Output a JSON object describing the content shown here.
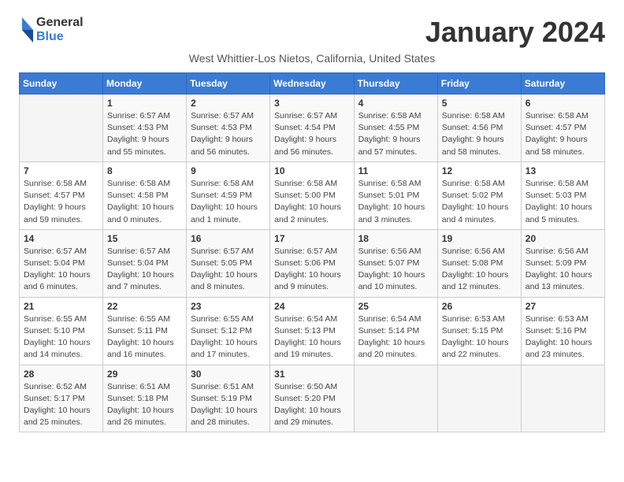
{
  "header": {
    "logo_line1": "General",
    "logo_line2": "Blue",
    "month_year": "January 2024",
    "subtitle": "West Whittier-Los Nietos, California, United States"
  },
  "days_of_week": [
    "Sunday",
    "Monday",
    "Tuesday",
    "Wednesday",
    "Thursday",
    "Friday",
    "Saturday"
  ],
  "weeks": [
    [
      {
        "day": "",
        "info": ""
      },
      {
        "day": "1",
        "info": "Sunrise: 6:57 AM\nSunset: 4:53 PM\nDaylight: 9 hours\nand 55 minutes."
      },
      {
        "day": "2",
        "info": "Sunrise: 6:57 AM\nSunset: 4:53 PM\nDaylight: 9 hours\nand 56 minutes."
      },
      {
        "day": "3",
        "info": "Sunrise: 6:57 AM\nSunset: 4:54 PM\nDaylight: 9 hours\nand 56 minutes."
      },
      {
        "day": "4",
        "info": "Sunrise: 6:58 AM\nSunset: 4:55 PM\nDaylight: 9 hours\nand 57 minutes."
      },
      {
        "day": "5",
        "info": "Sunrise: 6:58 AM\nSunset: 4:56 PM\nDaylight: 9 hours\nand 58 minutes."
      },
      {
        "day": "6",
        "info": "Sunrise: 6:58 AM\nSunset: 4:57 PM\nDaylight: 9 hours\nand 58 minutes."
      }
    ],
    [
      {
        "day": "7",
        "info": "Sunrise: 6:58 AM\nSunset: 4:57 PM\nDaylight: 9 hours\nand 59 minutes."
      },
      {
        "day": "8",
        "info": "Sunrise: 6:58 AM\nSunset: 4:58 PM\nDaylight: 10 hours\nand 0 minutes."
      },
      {
        "day": "9",
        "info": "Sunrise: 6:58 AM\nSunset: 4:59 PM\nDaylight: 10 hours\nand 1 minute."
      },
      {
        "day": "10",
        "info": "Sunrise: 6:58 AM\nSunset: 5:00 PM\nDaylight: 10 hours\nand 2 minutes."
      },
      {
        "day": "11",
        "info": "Sunrise: 6:58 AM\nSunset: 5:01 PM\nDaylight: 10 hours\nand 3 minutes."
      },
      {
        "day": "12",
        "info": "Sunrise: 6:58 AM\nSunset: 5:02 PM\nDaylight: 10 hours\nand 4 minutes."
      },
      {
        "day": "13",
        "info": "Sunrise: 6:58 AM\nSunset: 5:03 PM\nDaylight: 10 hours\nand 5 minutes."
      }
    ],
    [
      {
        "day": "14",
        "info": "Sunrise: 6:57 AM\nSunset: 5:04 PM\nDaylight: 10 hours\nand 6 minutes."
      },
      {
        "day": "15",
        "info": "Sunrise: 6:57 AM\nSunset: 5:04 PM\nDaylight: 10 hours\nand 7 minutes."
      },
      {
        "day": "16",
        "info": "Sunrise: 6:57 AM\nSunset: 5:05 PM\nDaylight: 10 hours\nand 8 minutes."
      },
      {
        "day": "17",
        "info": "Sunrise: 6:57 AM\nSunset: 5:06 PM\nDaylight: 10 hours\nand 9 minutes."
      },
      {
        "day": "18",
        "info": "Sunrise: 6:56 AM\nSunset: 5:07 PM\nDaylight: 10 hours\nand 10 minutes."
      },
      {
        "day": "19",
        "info": "Sunrise: 6:56 AM\nSunset: 5:08 PM\nDaylight: 10 hours\nand 12 minutes."
      },
      {
        "day": "20",
        "info": "Sunrise: 6:56 AM\nSunset: 5:09 PM\nDaylight: 10 hours\nand 13 minutes."
      }
    ],
    [
      {
        "day": "21",
        "info": "Sunrise: 6:55 AM\nSunset: 5:10 PM\nDaylight: 10 hours\nand 14 minutes."
      },
      {
        "day": "22",
        "info": "Sunrise: 6:55 AM\nSunset: 5:11 PM\nDaylight: 10 hours\nand 16 minutes."
      },
      {
        "day": "23",
        "info": "Sunrise: 6:55 AM\nSunset: 5:12 PM\nDaylight: 10 hours\nand 17 minutes."
      },
      {
        "day": "24",
        "info": "Sunrise: 6:54 AM\nSunset: 5:13 PM\nDaylight: 10 hours\nand 19 minutes."
      },
      {
        "day": "25",
        "info": "Sunrise: 6:54 AM\nSunset: 5:14 PM\nDaylight: 10 hours\nand 20 minutes."
      },
      {
        "day": "26",
        "info": "Sunrise: 6:53 AM\nSunset: 5:15 PM\nDaylight: 10 hours\nand 22 minutes."
      },
      {
        "day": "27",
        "info": "Sunrise: 6:53 AM\nSunset: 5:16 PM\nDaylight: 10 hours\nand 23 minutes."
      }
    ],
    [
      {
        "day": "28",
        "info": "Sunrise: 6:52 AM\nSunset: 5:17 PM\nDaylight: 10 hours\nand 25 minutes."
      },
      {
        "day": "29",
        "info": "Sunrise: 6:51 AM\nSunset: 5:18 PM\nDaylight: 10 hours\nand 26 minutes."
      },
      {
        "day": "30",
        "info": "Sunrise: 6:51 AM\nSunset: 5:19 PM\nDaylight: 10 hours\nand 28 minutes."
      },
      {
        "day": "31",
        "info": "Sunrise: 6:50 AM\nSunset: 5:20 PM\nDaylight: 10 hours\nand 29 minutes."
      },
      {
        "day": "",
        "info": ""
      },
      {
        "day": "",
        "info": ""
      },
      {
        "day": "",
        "info": ""
      }
    ]
  ]
}
